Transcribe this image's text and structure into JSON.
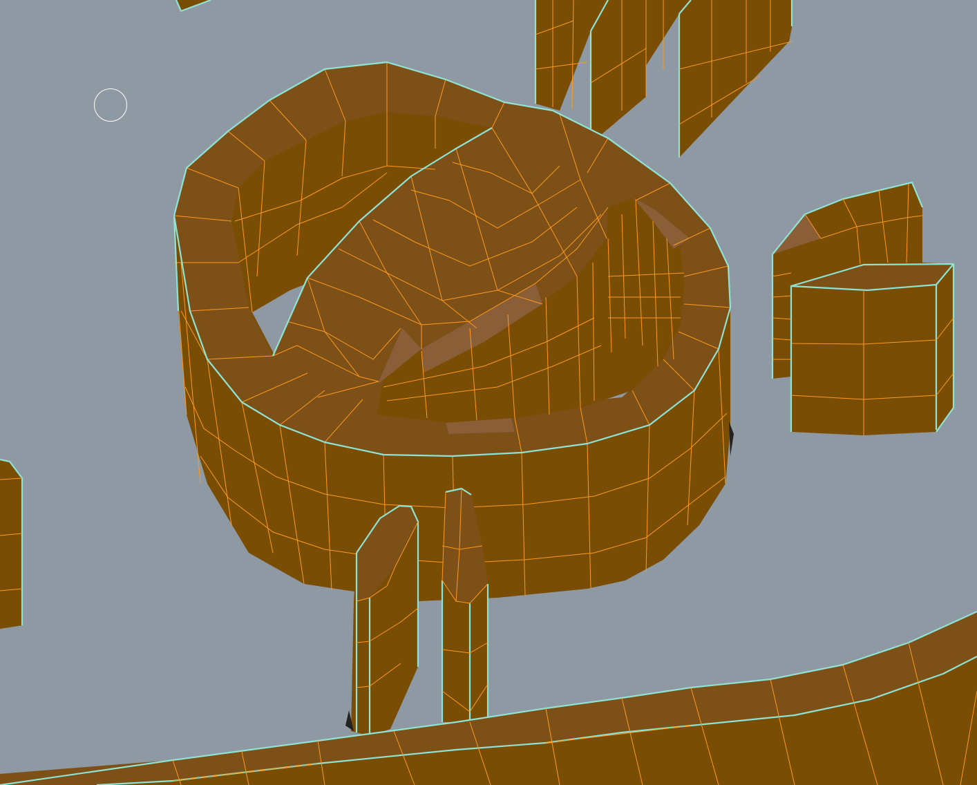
{
  "viewport": {
    "background_color": "#8f99a3",
    "mesh_face_color": "#7a4d05",
    "mesh_top_color": "#7d5018",
    "wire_color": "#ff9a1a",
    "boundary_edge_color": "#8fe3d4",
    "cursor_color": "#ffffff"
  },
  "cursor": {
    "icon": "brush-cursor-ring-icon"
  }
}
